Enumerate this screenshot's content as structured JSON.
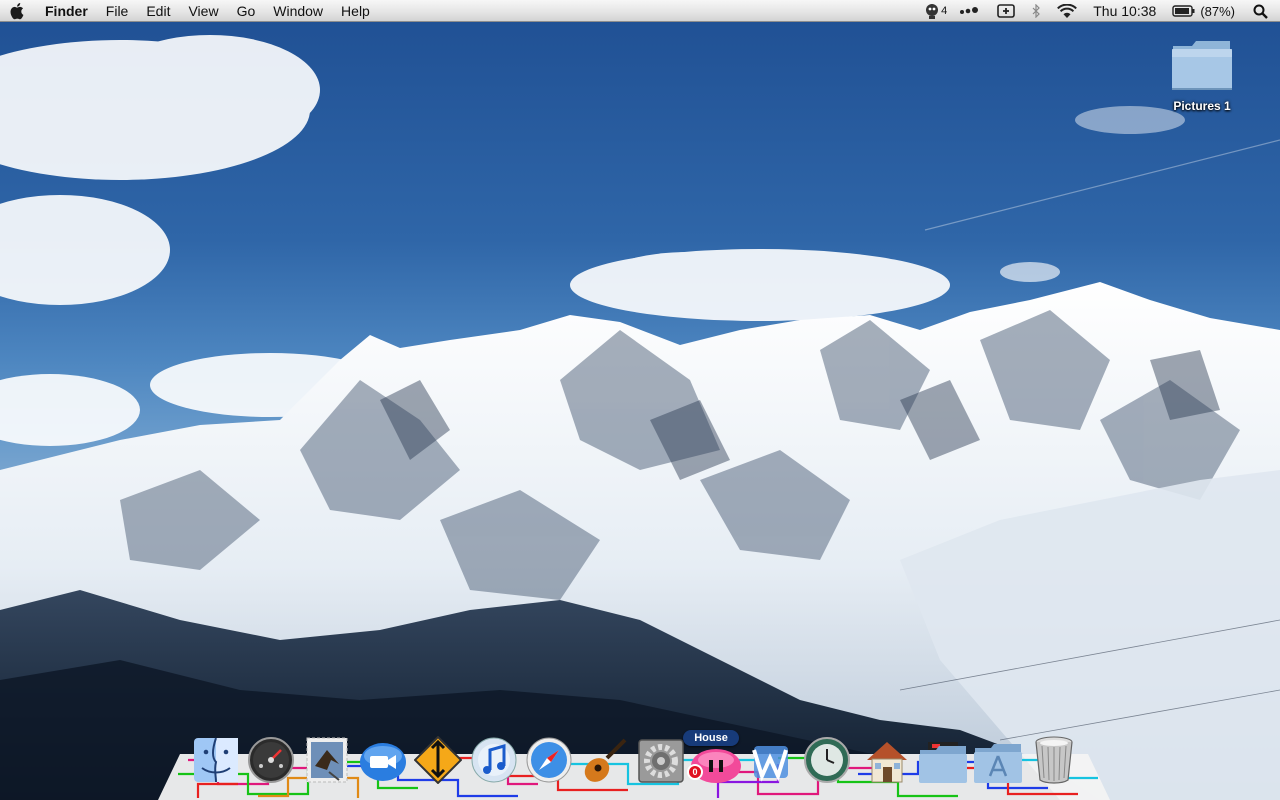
{
  "menubar": {
    "app_name": "Finder",
    "menus": [
      "File",
      "Edit",
      "View",
      "Go",
      "Window",
      "Help"
    ],
    "status": {
      "chat_count": "4",
      "clock": "Thu 10:38",
      "battery_percent": "(87%)"
    },
    "status_icons": [
      "chat-icon",
      "sync-dots-icon",
      "add-box-icon",
      "bluetooth-icon",
      "wifi-icon",
      "battery-icon",
      "spotlight-search-icon"
    ]
  },
  "desktop": {
    "icons": [
      {
        "label": "Pictures 1",
        "icon": "folder-icon"
      }
    ]
  },
  "dock": {
    "items": [
      {
        "name": "finder",
        "icon": "finder-icon"
      },
      {
        "name": "dashboard",
        "icon": "dashboard-icon"
      },
      {
        "name": "mail",
        "icon": "mail-stamp-icon"
      },
      {
        "name": "facetime",
        "icon": "video-camera-icon"
      },
      {
        "name": "transmit",
        "icon": "up-down-arrows-icon"
      },
      {
        "name": "itunes",
        "icon": "music-note-cd-icon"
      },
      {
        "name": "safari",
        "icon": "compass-icon"
      },
      {
        "name": "garageband",
        "icon": "guitar-icon"
      },
      {
        "name": "system-preferences",
        "icon": "gears-icon"
      },
      {
        "name": "house",
        "icon": "pink-house-app-icon",
        "label": "House",
        "badge": "0"
      },
      {
        "name": "word",
        "icon": "w-icon"
      },
      {
        "name": "time-machine",
        "icon": "time-machine-icon"
      },
      {
        "name": "home-folder",
        "icon": "home-icon"
      },
      {
        "name": "documents-stack",
        "icon": "folder-stack-icon"
      },
      {
        "name": "applications-folder",
        "icon": "applications-folder-icon"
      },
      {
        "name": "trash",
        "icon": "trash-icon"
      }
    ]
  },
  "colors": {
    "menubar_top": "#f7f7f7",
    "menubar_bottom": "#d3d3d3",
    "sky": "#2f66a8",
    "dock_shelf": "#f3f3f3"
  }
}
